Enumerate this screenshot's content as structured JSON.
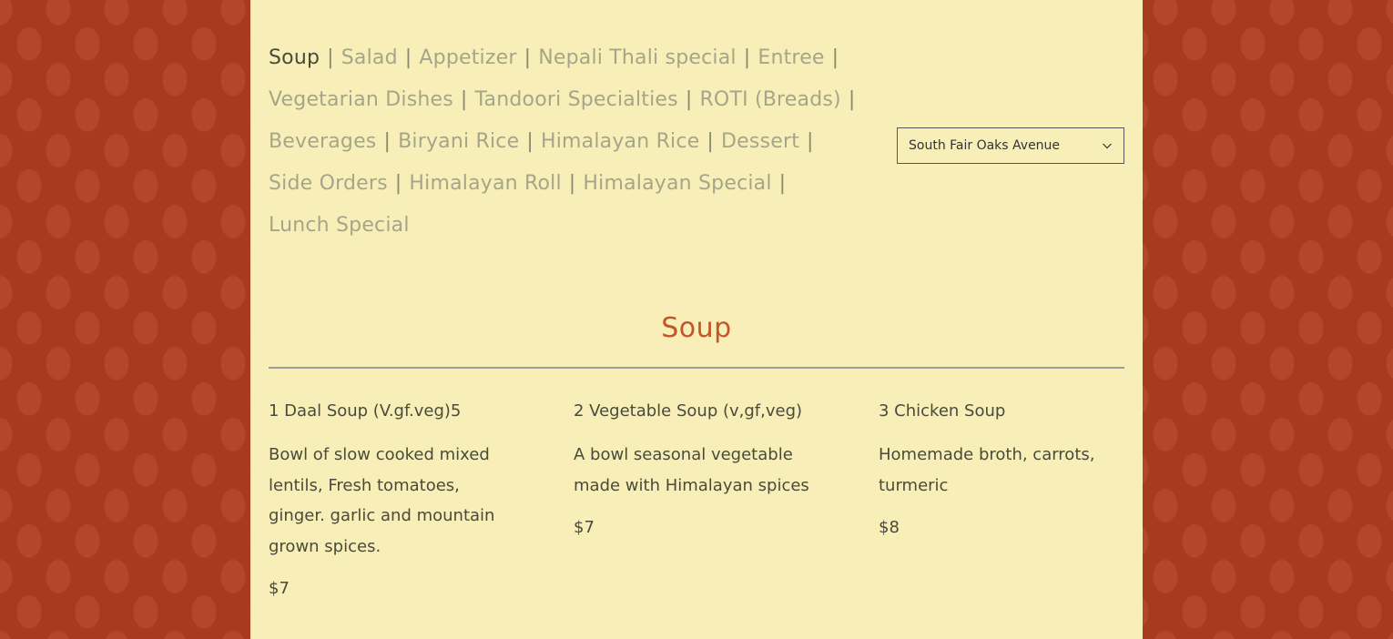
{
  "nav": {
    "active": "Soup",
    "separator": "|",
    "lines": [
      [
        "Soup",
        "Salad",
        "Appetizer",
        "Nepali Thali special",
        "Entree"
      ],
      [
        "Vegetarian Dishes",
        "Tandoori Specialties",
        "ROTI (Breads)"
      ],
      [
        "Beverages",
        "Biryani Rice",
        "Himalayan Rice",
        "Dessert"
      ],
      [
        "Side Orders",
        "Himalayan Roll",
        "Himalayan Special"
      ],
      [
        "Lunch Special"
      ]
    ]
  },
  "location_select": {
    "value": "South Fair Oaks Avenue",
    "icon": "chevron-down-icon"
  },
  "section": {
    "title": "Soup",
    "items": [
      {
        "name": "1 Daal Soup (V.gf.veg)5",
        "description": "Bowl of slow cooked mixed lentils, Fresh tomatoes, ginger. garlic and mountain grown spices.",
        "price": "$7"
      },
      {
        "name": "2 Vegetable Soup (v,gf,veg)",
        "description": "A bowl seasonal vegetable made with Himalayan spices",
        "price": "$7"
      },
      {
        "name": "3 Chicken Soup",
        "description": "Homemade broth, carrots, turmeric",
        "price": "$8"
      }
    ]
  },
  "colors": {
    "background": "#a83a1e",
    "panel": "#f8efb8",
    "accent": "#c4542a",
    "nav_inactive": "#a5a58a",
    "text": "#4a4a3a"
  }
}
